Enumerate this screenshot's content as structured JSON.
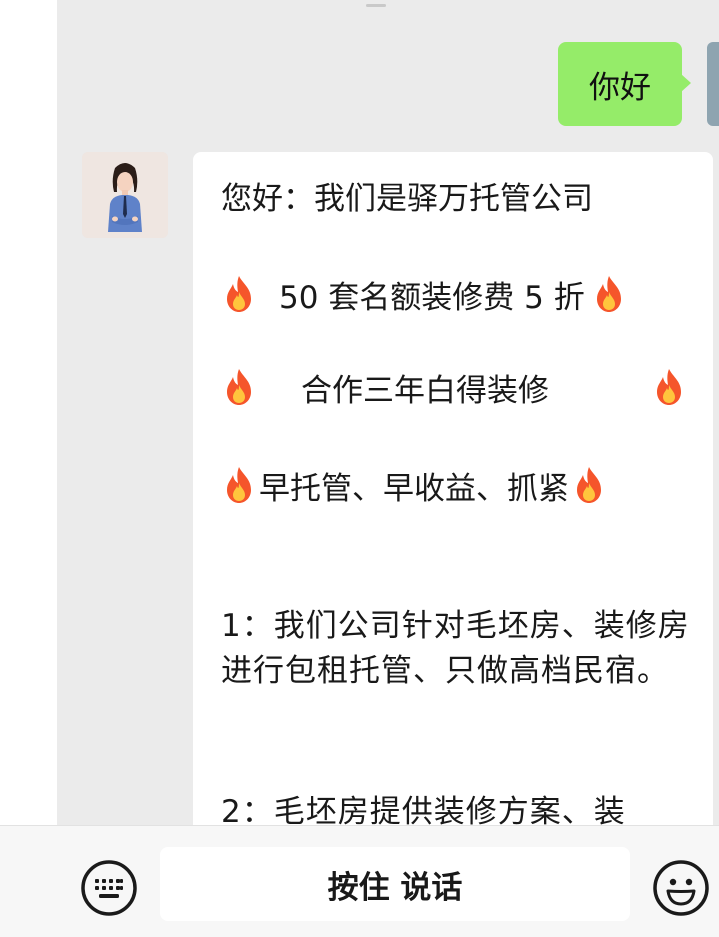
{
  "chat": {
    "outgoing": {
      "text": "你好",
      "bubble_color": "#95ec69"
    },
    "incoming": {
      "greeting": "您好：我们是驿万托管公司",
      "line_promo": "50 套名额装修费 5 折",
      "line_coop": "合作三年白得装修",
      "line_urge": "早托管、早收益、抓紧",
      "para1": "1：我们公司针对毛坯房、装修房进行包租托管、只做高档民宿。",
      "para2": "2：毛坯房提供装修方案、装",
      "bubble_color": "#ffffff",
      "icons": [
        "fire-emoji",
        "fire-emoji",
        "fire-emoji",
        "fire-emoji",
        "fire-emoji",
        "fire-emoji"
      ]
    }
  },
  "input_bar": {
    "hold_to_talk_label": "按住 说话",
    "left_icon": "keyboard-icon",
    "right_icon": "emoji-smile-icon"
  },
  "colors": {
    "background": "#ebebeb",
    "outgoing_bubble": "#95ec69",
    "fire": "#f5552b"
  }
}
